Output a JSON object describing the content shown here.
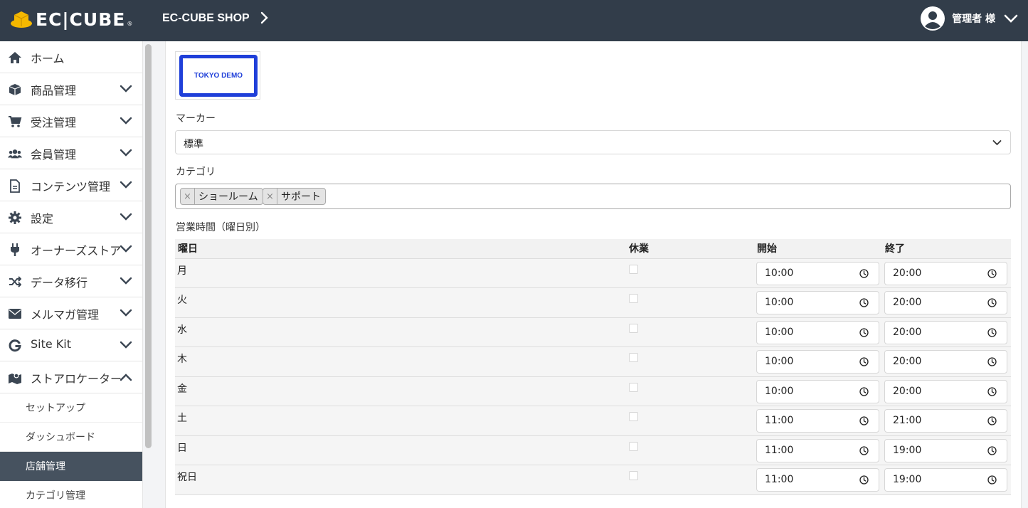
{
  "header": {
    "logo_text": "EC|CUBE",
    "logo_reg": "®",
    "shop_name": "EC-CUBE SHOP",
    "user_name": "管理者 様"
  },
  "sidebar": {
    "items": [
      {
        "label": "ホーム",
        "icon": "home-icon",
        "expandable": false
      },
      {
        "label": "商品管理",
        "icon": "box-icon",
        "expandable": true
      },
      {
        "label": "受注管理",
        "icon": "cart-icon",
        "expandable": true
      },
      {
        "label": "会員管理",
        "icon": "users-icon",
        "expandable": true
      },
      {
        "label": "コンテンツ管理",
        "icon": "file-icon",
        "expandable": true
      },
      {
        "label": "設定",
        "icon": "gear-icon",
        "expandable": true
      },
      {
        "label": "オーナーズストア",
        "icon": "plug-icon",
        "expandable": true
      },
      {
        "label": "データ移行",
        "icon": "shuffle-icon",
        "expandable": true
      },
      {
        "label": "メルマガ管理",
        "icon": "envelope-icon",
        "expandable": true
      },
      {
        "label": "Site Kit",
        "icon": "google-icon",
        "expandable": true
      },
      {
        "label": "ストアロケーター",
        "icon": "map-icon",
        "expandable": true,
        "open": true
      }
    ],
    "sub_items": [
      {
        "label": "セットアップ",
        "active": false
      },
      {
        "label": "ダッシュボード",
        "active": false
      },
      {
        "label": "店舗管理",
        "active": true
      },
      {
        "label": "カテゴリ管理",
        "active": false
      }
    ]
  },
  "main": {
    "image_text": "TOKYO DEMO",
    "marker_label": "マーカー",
    "marker_value": "標準",
    "category_label": "カテゴリ",
    "category_tags": [
      "ショールーム",
      "サポート"
    ],
    "tag_remove": "×",
    "hours_label": "営業時間（曜日別）",
    "hours_table": {
      "columns": [
        "曜日",
        "休業",
        "開始",
        "終了"
      ],
      "rows": [
        {
          "day": "月",
          "closed": false,
          "start": "10:00",
          "end": "20:00"
        },
        {
          "day": "火",
          "closed": false,
          "start": "10:00",
          "end": "20:00"
        },
        {
          "day": "水",
          "closed": false,
          "start": "10:00",
          "end": "20:00"
        },
        {
          "day": "木",
          "closed": false,
          "start": "10:00",
          "end": "20:00"
        },
        {
          "day": "金",
          "closed": false,
          "start": "10:00",
          "end": "20:00"
        },
        {
          "day": "土",
          "closed": false,
          "start": "11:00",
          "end": "21:00"
        },
        {
          "day": "日",
          "closed": false,
          "start": "11:00",
          "end": "19:00"
        },
        {
          "day": "祝日",
          "closed": false,
          "start": "11:00",
          "end": "19:00"
        }
      ]
    }
  },
  "colors": {
    "header_bg": "#323d4a",
    "active_sub_bg": "#46525f",
    "logo_gold": "#f5b800",
    "image_blue": "#1f3fd9"
  }
}
